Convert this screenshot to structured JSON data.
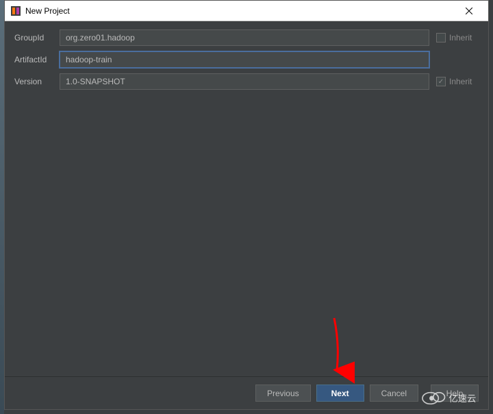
{
  "window": {
    "title": "New Project"
  },
  "form": {
    "groupId": {
      "label": "GroupId",
      "value": "org.zero01.hadoop"
    },
    "artifactId": {
      "label": "ArtifactId",
      "value": "hadoop-train"
    },
    "version": {
      "label": "Version",
      "value": "1.0-SNAPSHOT"
    },
    "inherit_label": "Inherit"
  },
  "buttons": {
    "previous": "Previous",
    "next": "Next",
    "cancel": "Cancel",
    "help": "Help"
  },
  "watermark": "亿速云"
}
